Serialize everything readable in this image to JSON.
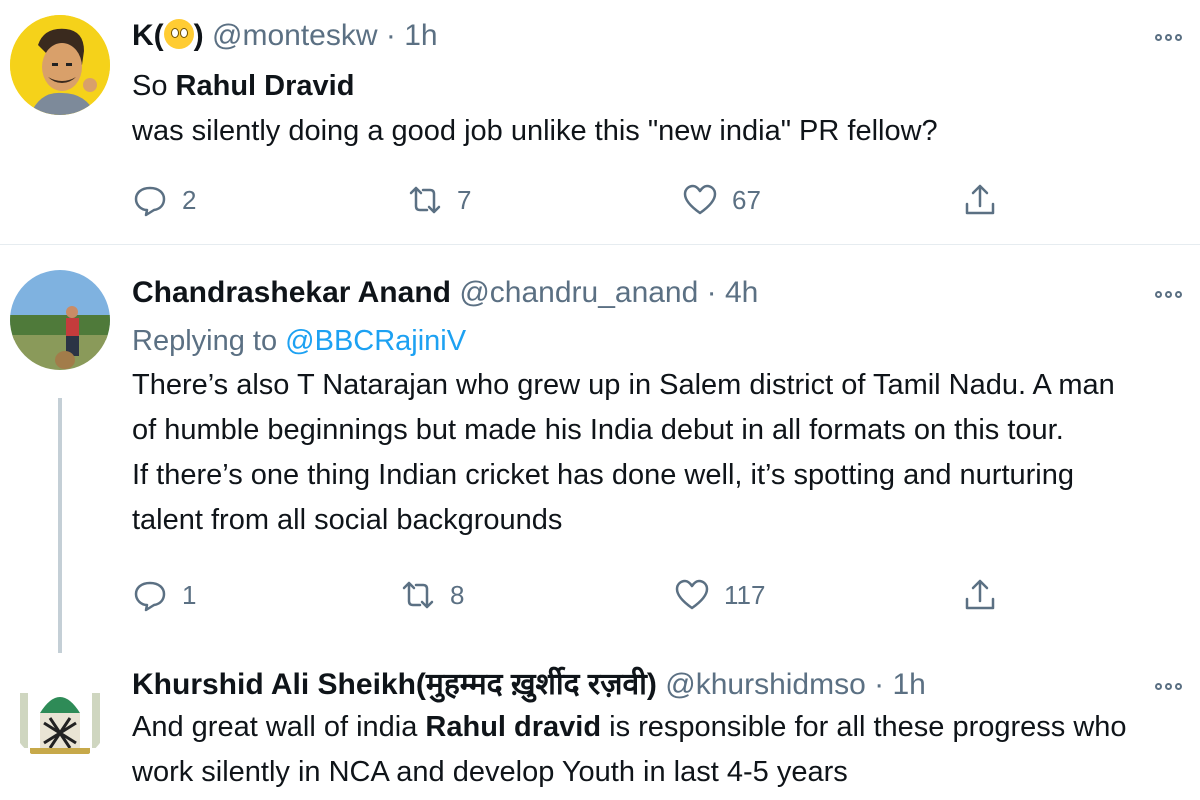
{
  "tweets": [
    {
      "author_name": "K(",
      "author_name_suffix": ")",
      "handle": "@monteskw",
      "sep": "·",
      "time": "1h",
      "text_parts": [
        "So ",
        "Rahul Dravid",
        " was silently doing a good job unlike this \"new india\" PR fellow?"
      ],
      "replies": "2",
      "retweets": "7",
      "likes": "67"
    },
    {
      "author_name": "Chandrashekar Anand",
      "handle": "@chandru_anand",
      "sep": "·",
      "time": "4h",
      "replying_label": "Replying to",
      "replying_handle": "@BBCRajiniV",
      "text_lines": [
        "There’s also T Natarajan who grew up in Salem district of Tamil Nadu. A man",
        "of humble beginnings but made his India debut in all formats on this tour.",
        "If there’s one thing Indian cricket has done well, it’s spotting and nurturing",
        "talent from all social backgrounds"
      ],
      "replies": "1",
      "retweets": "8",
      "likes": "117"
    },
    {
      "author_name": "Khurshid Ali Sheikh(मुहम्मद ख़ुर्शीद रज़वी)",
      "handle": "@khurshidmso",
      "sep": "·",
      "time": "1h",
      "text_parts": [
        "And great wall of india ",
        "Rahul dravid",
        " is responsible for all these progress who work silently in NCA and develop Youth in last 4-5 years"
      ]
    }
  ],
  "icons": {
    "reply": "reply-icon",
    "retweet": "retweet-icon",
    "like": "heart-icon",
    "share": "share-icon",
    "more": "more-options-icon",
    "emoji": "face-with-rolling-eyes-emoji"
  },
  "colors": {
    "text": "#0f1419",
    "secondary": "#5b7083",
    "link": "#1da1f2",
    "divider": "#e6ecf0",
    "thread": "#c4cfd6"
  }
}
